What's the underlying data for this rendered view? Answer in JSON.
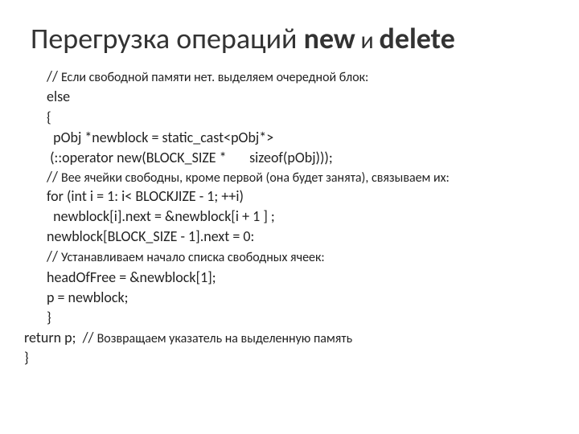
{
  "title": {
    "part1": "Перегрузка операций  ",
    "kw1": "new",
    "conn": " и ",
    "kw2": "delete"
  },
  "code": {
    "l1_a": "// ",
    "l1_b": "Если свободной памяти нет. выделяем очередной блок:",
    "l2": "else",
    "l3": "{",
    "l4": "  pObj *newblock = static_cast<pObj*>",
    "l5": " (::operator new(BLOCK_SIZE *       sizeof(pObj)));",
    "l6_a": "// ",
    "l6_b": "Bee ячейки свободны, кроме первой (она будет занята), связываем их:",
    "l7": "for (int i = 1: i< BLOCKJIZE - 1; ++i)",
    "l8": "  newblock[i].next = &newblock[i + 1 ] ;",
    "l9": "newblock[BLOCK_SIZE - 1].next = 0:",
    "l10_a": "// ",
    "l10_b": "Устанавливаем начало списка свободных ячеек:",
    "l11": "headOfFree = &newblock[1];",
    "l12": "р = newblock;",
    "l13": "}",
    "l14_a": "return p;  // ",
    "l14_b": "Возвращаем указатель на выделенную память",
    "l15": "}"
  }
}
